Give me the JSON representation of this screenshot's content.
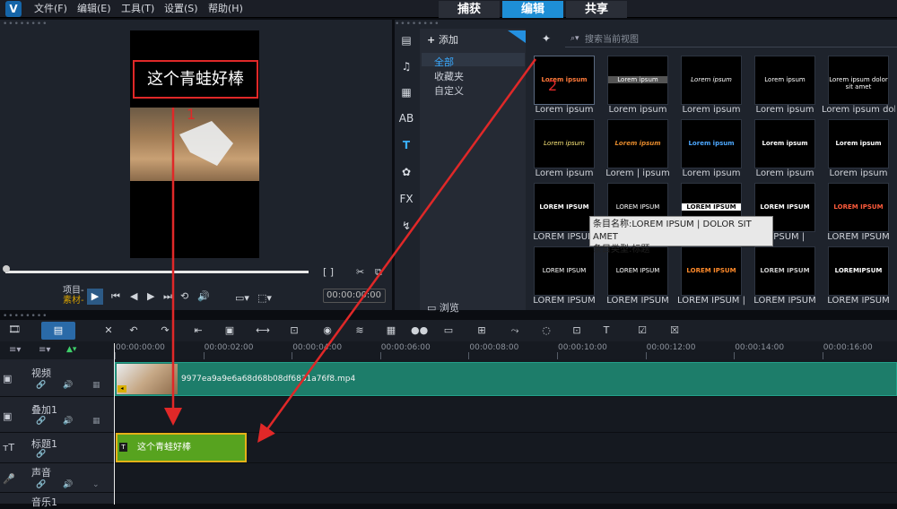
{
  "menu": {
    "logo": "V",
    "items": [
      "文件(F)",
      "编辑(E)",
      "工具(T)",
      "设置(S)",
      "帮助(H)"
    ]
  },
  "mode_tabs": {
    "capture": "捕获",
    "edit": "编辑",
    "share": "共享",
    "active": "edit"
  },
  "preview": {
    "video_title": "这个青蛙好棒",
    "project_label": "项目-",
    "clip_label": "素材-",
    "timecode": "00:00:00:00",
    "annotation_1": "1"
  },
  "library": {
    "add_label": "添加",
    "categories": [
      "全部",
      "收藏夹",
      "自定义"
    ],
    "selected_category": "全部",
    "browse_label": "浏览",
    "search_placeholder": "搜索当前视图",
    "annotation_2": "2",
    "thumb_previews": [
      [
        "Lorem ipsum",
        "Lorem ipsum",
        "Lorem ipsum",
        "Lorem ipsum",
        "Lorem ipsum dolor sit amet"
      ],
      [
        "Lorem ipsum",
        "Lorem ipsum",
        "Lorem ipsum",
        "Lorem ipsum",
        "Lorem ipsum"
      ],
      [
        "LOREM IPSUM",
        "LOREM IPSUM",
        "LOREM IPSUM",
        "LOREM IPSUM",
        "LOREM IPSUM"
      ],
      [
        "LOREM IPSUM",
        "LOREM IPSUM",
        "LOREM IPSUM",
        "LOREM IPSUM",
        "LOREMIPSUM"
      ]
    ],
    "thumb_labels": [
      [
        "Lorem ipsum",
        "Lorem ipsum",
        "Lorem ipsum",
        "Lorem ipsum",
        "Lorem ipsum dolor sit"
      ],
      [
        "Lorem ipsum",
        "Lorem | ipsum",
        "Lorem ipsum",
        "Lorem ipsum",
        "Lorem ipsum"
      ],
      [
        "LOREM IPSUM",
        "",
        "",
        "| IPSUM |",
        "LOREM IPSUM"
      ],
      [
        "LOREM IPSUM",
        "LOREM IPSUM",
        "LOREM IPSUM |",
        "LOREM IPSUM",
        "LOREM IPSUM"
      ]
    ],
    "tooltip": {
      "line1": "条目名称:LOREM IPSUM | DOLOR SIT AMET",
      "line2": "条目类型:标题"
    }
  },
  "timeline": {
    "ruler_ticks": [
      "00:00:00:00",
      "00:00:02:00",
      "00:00:04:00",
      "00:00:06:00",
      "00:00:08:00",
      "00:00:10:00",
      "00:00:12:00",
      "00:00:14:00",
      "00:00:16:00"
    ],
    "tracks": [
      {
        "name": "视频"
      },
      {
        "name": "叠加1"
      },
      {
        "name": "标题1"
      },
      {
        "name": "声音"
      },
      {
        "name": "音乐1"
      }
    ],
    "video_clip_name": "9977ea9a9e6a68d68b08df6831a76f8.mp4",
    "title_clip_text": "这个青蛙好棒",
    "title_clip_badge": "T"
  },
  "colors": {
    "accent": "#1e8fd6",
    "annotation": "#e02828",
    "video_clip": "#1d7d6a",
    "title_clip": "#57a31f"
  }
}
